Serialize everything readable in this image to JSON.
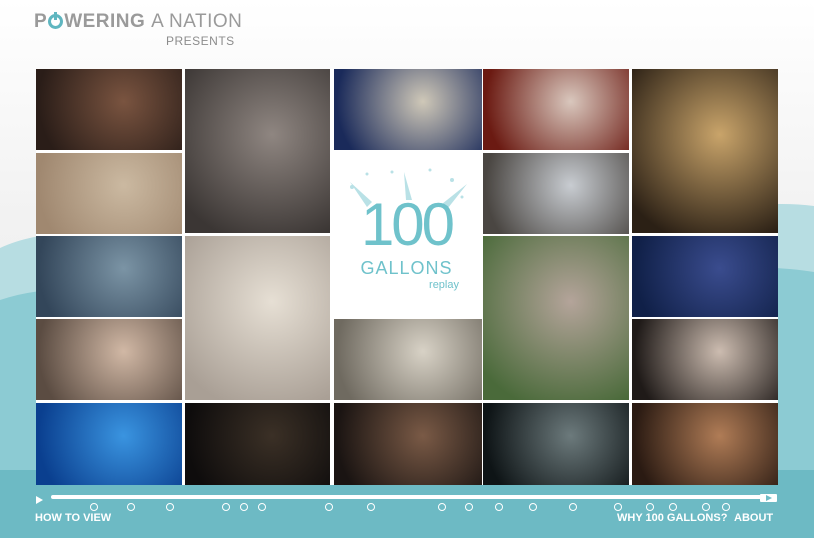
{
  "header": {
    "brand_part1": "P",
    "brand_part2": "WERING",
    "brand_part3": "A NATION",
    "presents": "PRESENTS"
  },
  "feature": {
    "number": "100",
    "title": "GALLONS",
    "subtitle": "replay"
  },
  "videos": [
    {
      "id": "portrait-sweat",
      "colors": [
        "#2a1d18",
        "#7a5440"
      ]
    },
    {
      "id": "faucet-drip",
      "colors": [
        "#3b3634",
        "#8f8681"
      ]
    },
    {
      "id": "empty-pool",
      "colors": [
        "#1a2a5a",
        "#cfc8b8"
      ]
    },
    {
      "id": "pouring-glass",
      "colors": [
        "#6b1a12",
        "#d9c7bd"
      ]
    },
    {
      "id": "tunnel-light",
      "colors": [
        "#2b2015",
        "#c9a46a"
      ]
    },
    {
      "id": "beach-runner",
      "colors": [
        "#a08870",
        "#cbb9a1"
      ]
    },
    {
      "id": "bottles",
      "colors": [
        "#4a4642",
        "#c8ccd1"
      ]
    },
    {
      "id": "boy-sea",
      "colors": [
        "#33465a",
        "#7b94a5"
      ]
    },
    {
      "id": "woman-crying",
      "colors": [
        "#a99f95",
        "#e6dfd4"
      ]
    },
    {
      "id": "girl-lake",
      "colors": [
        "#4a6a3a",
        "#b4a49a"
      ]
    },
    {
      "id": "man-blue",
      "colors": [
        "#102048",
        "#3a4c8e"
      ]
    },
    {
      "id": "baby-bath",
      "colors": [
        "#5b4c42",
        "#d1b8a5"
      ]
    },
    {
      "id": "legs-drain",
      "colors": [
        "#6f6a60",
        "#d8d2c6"
      ]
    },
    {
      "id": "hair-wash",
      "colors": [
        "#1f1a18",
        "#ccbcb0"
      ]
    },
    {
      "id": "aquarium",
      "colors": [
        "#0a3f8f",
        "#3a94e0"
      ]
    },
    {
      "id": "night-drink",
      "colors": [
        "#0e0c0c",
        "#3b3026"
      ]
    },
    {
      "id": "cat-basin",
      "colors": [
        "#1a1412",
        "#7a5a46"
      ]
    },
    {
      "id": "rain-boy",
      "colors": [
        "#0e1416",
        "#6c7a7c"
      ]
    },
    {
      "id": "old-man",
      "colors": [
        "#2a1a12",
        "#b07c56"
      ]
    }
  ],
  "timeline": {
    "markers": 18
  },
  "footer": {
    "how_to_view": "HOW TO VIEW",
    "why": "WHY 100 GALLONS?",
    "about": "ABOUT"
  },
  "colors": {
    "accent": "#6fc2cb",
    "logo_gray": "#9a9a9a",
    "footer_teal": "#6dbac4"
  },
  "icons": [
    "power-icon",
    "play-icon",
    "fullscreen-icon"
  ]
}
